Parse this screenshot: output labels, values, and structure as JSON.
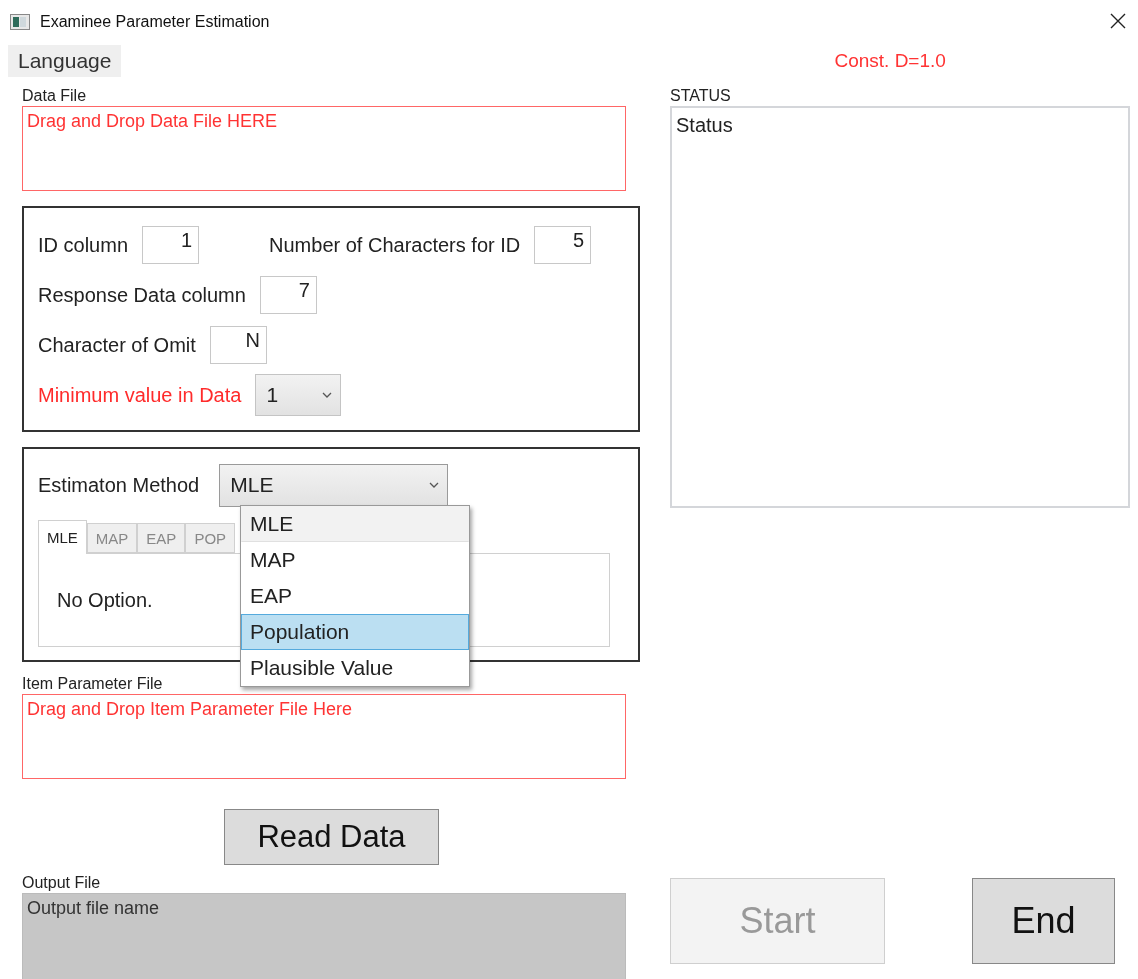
{
  "window": {
    "title": "Examinee Parameter Estimation"
  },
  "menu": [
    {
      "label": "Language"
    }
  ],
  "constant_label": "Const. D=1.0",
  "data_file": {
    "label": "Data File",
    "placeholder": "Drag and Drop Data File HERE"
  },
  "settings": [
    [
      {
        "kind": "text",
        "label": "ID column",
        "value": "1",
        "warning": false
      },
      {
        "kind": "text",
        "label": "Number of Characters for ID",
        "value": "5",
        "warning": false
      }
    ],
    [
      {
        "kind": "text",
        "label": "Response Data column",
        "value": "7",
        "warning": false
      }
    ],
    [
      {
        "kind": "text",
        "label": "Character of Omit",
        "value": "N",
        "warning": false
      }
    ],
    [
      {
        "kind": "select",
        "label": "Minimum value in Data",
        "value": "1",
        "warning": true
      }
    ]
  ],
  "estimation": {
    "label": "Estimaton Method",
    "value": "MLE",
    "expanded": true,
    "options": [
      {
        "label": "MLE",
        "selected": true,
        "highlighted": false
      },
      {
        "label": "MAP",
        "selected": false,
        "highlighted": false
      },
      {
        "label": "EAP",
        "selected": false,
        "highlighted": false
      },
      {
        "label": "Population",
        "selected": false,
        "highlighted": true
      },
      {
        "label": "Plausible Value",
        "selected": false,
        "highlighted": false
      }
    ],
    "tabs": [
      {
        "label": "MLE",
        "selected": true
      },
      {
        "label": "MAP",
        "selected": false
      },
      {
        "label": "EAP",
        "selected": false
      },
      {
        "label": "POP",
        "selected": false
      }
    ],
    "tab_text": "No Option."
  },
  "item_parameter_file": {
    "label": "Item Parameter File",
    "placeholder": "Drag and Drop Item Parameter File Here"
  },
  "read_button": "Read Data",
  "output_file": {
    "label": "Output File",
    "value": "Output file name",
    "disabled": true
  },
  "status": {
    "label": "STATUS",
    "text": "Status"
  },
  "buttons": [
    {
      "label": "Start",
      "disabled": true
    },
    {
      "label": "End",
      "disabled": false
    }
  ]
}
